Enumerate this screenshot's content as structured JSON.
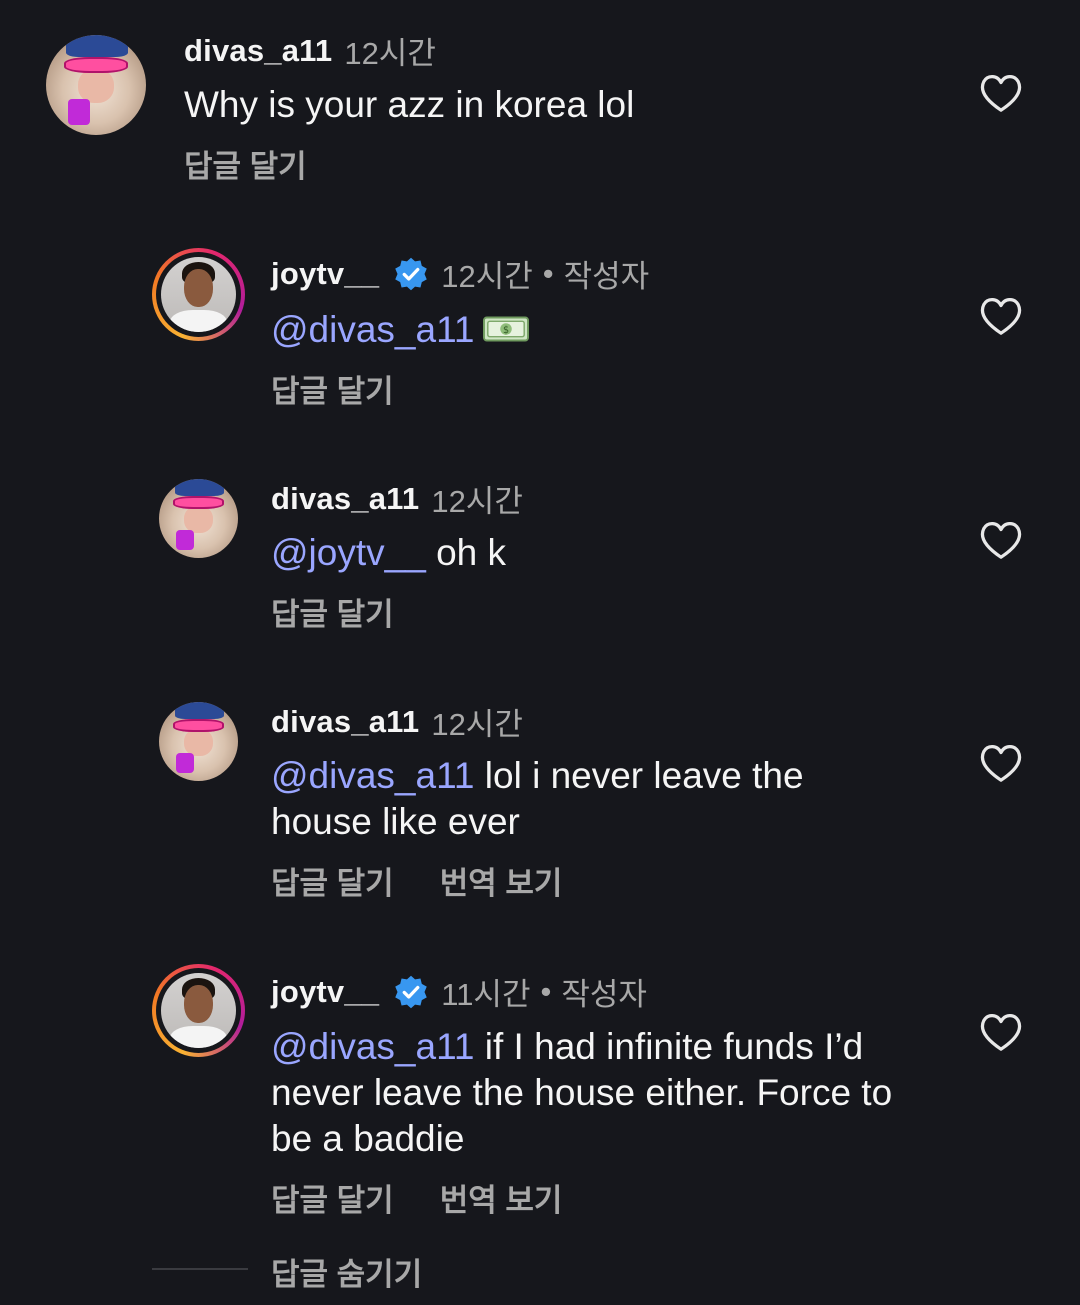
{
  "comments": [
    {
      "username": "divas_a11",
      "time": "12시간",
      "text": "Why is your azz in korea lol",
      "actions": [
        "답글 달기"
      ]
    },
    {
      "username": "joytv__",
      "time": "12시간",
      "dot": "•",
      "author_tag": "작성자",
      "mention": "@divas_a11",
      "text": "",
      "emoji": "money-with-wings",
      "actions": [
        "답글 달기"
      ]
    },
    {
      "username": "divas_a11",
      "time": "12시간",
      "mention": "@joytv__",
      "text": " oh k",
      "actions": [
        "답글 달기"
      ]
    },
    {
      "username": "divas_a11",
      "time": "12시간",
      "mention": "@divas_a11",
      "text": " lol i never leave the house like ever",
      "actions": [
        "답글 달기",
        "번역 보기"
      ]
    },
    {
      "username": "joytv__",
      "time": "11시간",
      "dot": "•",
      "author_tag": "작성자",
      "mention": "@divas_a11",
      "text": " if I had infinite funds I’d never leave the house either. Force to be a baddie",
      "actions": [
        "답글 달기",
        "번역 보기"
      ]
    }
  ],
  "hide_replies_label": "답글 숨기기",
  "colors": {
    "background": "#16171c",
    "mention": "#9aa6ff",
    "muted": "#a8a8a8",
    "verified": "#3897f0"
  },
  "icons": {
    "like": "heart-outline-icon",
    "verified": "verified-badge-icon"
  }
}
